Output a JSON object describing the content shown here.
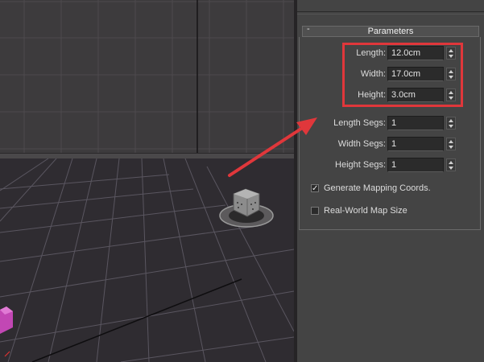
{
  "command_panel": {
    "rollout_title": "Parameters",
    "collapse_symbol": "-",
    "fields": [
      {
        "label": "Length:",
        "value": "12.0cm"
      },
      {
        "label": "Width:",
        "value": "17.0cm"
      },
      {
        "label": "Height:",
        "value": "3.0cm"
      },
      {
        "label": "Length Segs:",
        "value": "1"
      },
      {
        "label": "Width Segs:",
        "value": "1"
      },
      {
        "label": "Height Segs:",
        "value": "1"
      }
    ],
    "checkboxes": [
      {
        "label": "Generate Mapping Coords.",
        "checked": true,
        "mark": "✓"
      },
      {
        "label": "Real-World Map Size",
        "checked": false,
        "mark": ""
      }
    ]
  },
  "icons": {
    "spinner": "spinner-arrows-icon",
    "light_object": "light-gizmo-icon",
    "annotation_arrow": "red-arrow-icon"
  },
  "colors": {
    "highlight": "#e0373b",
    "panel_bg": "#444444",
    "viewport_bg": "#2f2c31",
    "box_magenta": "#c247b4"
  }
}
